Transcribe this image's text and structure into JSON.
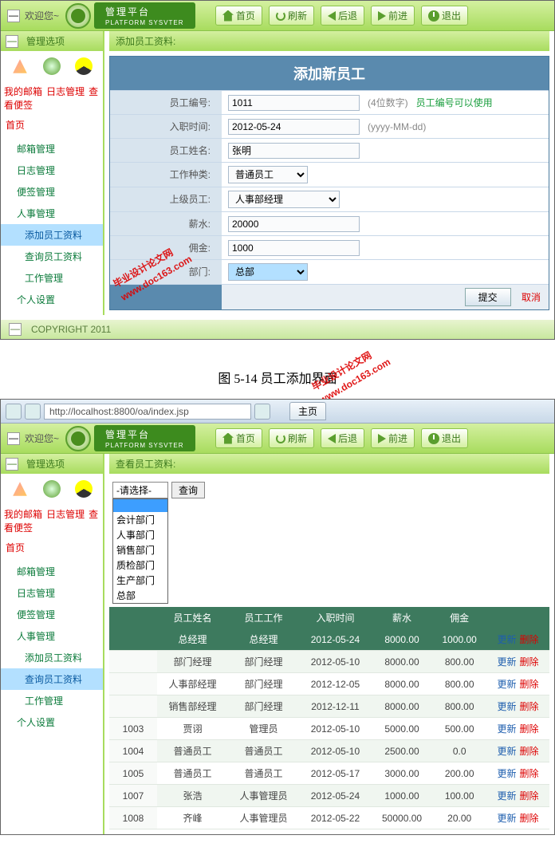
{
  "header": {
    "welcome": "欢迎您~",
    "platform": "管理平台",
    "platform_sub": "PLATFORM SYSVTER",
    "nav": {
      "home": "首页",
      "refresh": "刷新",
      "back": "后退",
      "forward": "前进",
      "exit": "退出"
    }
  },
  "sidebar": {
    "title": "管理选项",
    "links": {
      "mail": "我的邮箱",
      "log": "日志管理",
      "note": "查看便签"
    },
    "first": "首页",
    "items": [
      "邮箱管理",
      "日志管理",
      "便签管理",
      "人事管理"
    ],
    "sub": {
      "add_emp": "添加员工资料",
      "view_emp": "查询员工资料",
      "work": "工作管理"
    },
    "personal": "个人设置"
  },
  "copyright": "COPYRIGHT   2011",
  "screen1": {
    "main_title": "添加员工资料:",
    "form_title": "添加新员工",
    "fields": {
      "emp_id": {
        "label": "员工编号:",
        "value": "1011",
        "hint_prefix": "(4位数字)",
        "hint": "员工编号可以使用"
      },
      "hire_date": {
        "label": "入职时间:",
        "value": "2012-05-24",
        "hint": "(yyyy-MM-dd)"
      },
      "emp_name": {
        "label": "员工姓名:",
        "value": "张明"
      },
      "job_type": {
        "label": "工作种类:",
        "value": "普通员工"
      },
      "supervisor": {
        "label": "上级员工:",
        "value": "人事部经理"
      },
      "salary": {
        "label": "薪水:",
        "value": "20000"
      },
      "bonus": {
        "label": "佣金:",
        "value": "1000"
      },
      "dept": {
        "label": "部门:",
        "value": "总部"
      }
    },
    "submit": "提交",
    "cancel": "取消"
  },
  "caption": "图 5-14   员工添加界面",
  "watermark": {
    "line1": "毕业设计论文网",
    "line2": "www.doc163.com"
  },
  "screen2": {
    "url": "http://localhost:8800/oa/index.jsp",
    "tab_title": "主页",
    "main_title": "查看员工资料:",
    "select_placeholder": "-请选择-",
    "query_btn": "查询",
    "dropdown_options": [
      "会计部门",
      "人事部门",
      "销售部门",
      "质检部门",
      "生产部门",
      "总部"
    ],
    "columns": [
      "员工姓名",
      "员工工作",
      "入职时间",
      "薪水",
      "佣金"
    ],
    "actions": {
      "update": "更新",
      "delete": "删除"
    },
    "rows": [
      {
        "name": "总经理",
        "job": "总经理",
        "date": "2012-05-24",
        "salary": "8000.00",
        "bonus": "1000.00",
        "dark": true
      },
      {
        "id": "",
        "name": "部门经理",
        "job": "部门经理",
        "date": "2012-05-10",
        "salary": "8000.00",
        "bonus": "800.00"
      },
      {
        "id": "",
        "name": "人事部经理",
        "job": "部门经理",
        "date": "2012-12-05",
        "salary": "8000.00",
        "bonus": "800.00"
      },
      {
        "id": "",
        "name": "销售部经理",
        "job": "部门经理",
        "date": "2012-12-11",
        "salary": "8000.00",
        "bonus": "800.00"
      },
      {
        "id": "1003",
        "name": "贾诩",
        "job": "管理员",
        "date": "2012-05-10",
        "salary": "5000.00",
        "bonus": "500.00"
      },
      {
        "id": "1004",
        "name": "普通员工",
        "job": "普通员工",
        "date": "2012-05-10",
        "salary": "2500.00",
        "bonus": "0.0"
      },
      {
        "id": "1005",
        "name": "普通员工",
        "job": "普通员工",
        "date": "2012-05-17",
        "salary": "3000.00",
        "bonus": "200.00"
      },
      {
        "id": "1007",
        "name": "张浩",
        "job": "人事管理员",
        "date": "2012-05-24",
        "salary": "1000.00",
        "bonus": "100.00"
      },
      {
        "id": "1008",
        "name": "齐峰",
        "job": "人事管理员",
        "date": "2012-05-22",
        "salary": "50000.00",
        "bonus": "20.00"
      }
    ]
  }
}
